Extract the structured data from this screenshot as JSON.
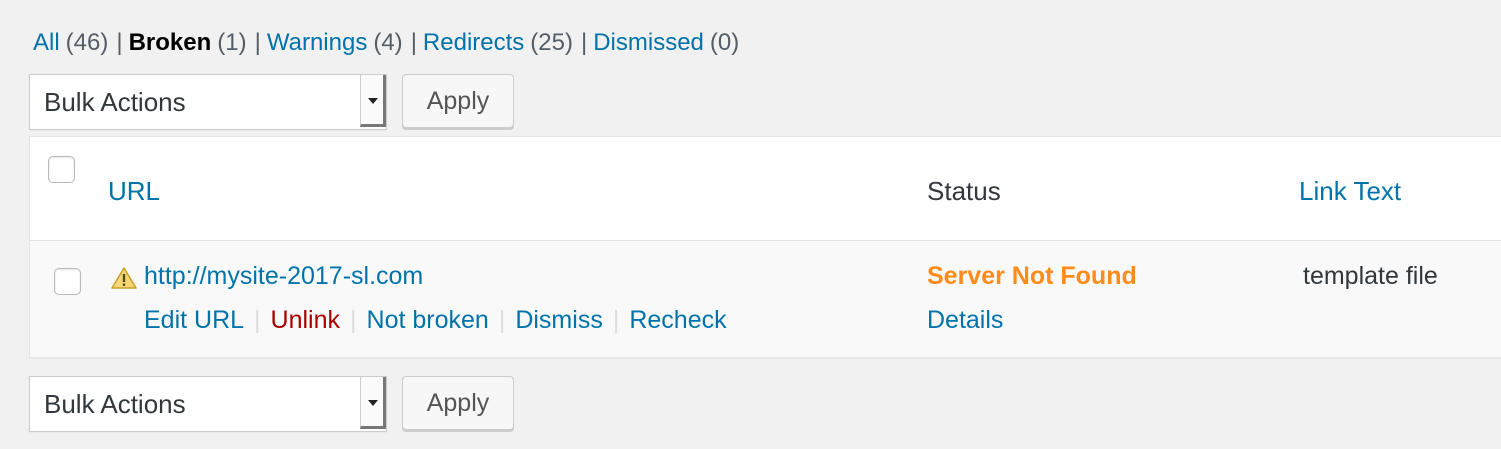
{
  "filters": [
    {
      "label": "All",
      "count": "(46)"
    },
    {
      "label": "Broken",
      "count": "(1)"
    },
    {
      "label": "Warnings",
      "count": "(4)"
    },
    {
      "label": "Redirects",
      "count": "(25)"
    },
    {
      "label": "Dismissed",
      "count": "(0)"
    }
  ],
  "filter_separator": "|",
  "bulk_actions": {
    "top": {
      "select_label": "Bulk Actions",
      "apply_label": "Apply"
    },
    "bottom": {
      "select_label": "Bulk Actions",
      "apply_label": "Apply"
    }
  },
  "table": {
    "columns": {
      "url": "URL",
      "status": "Status",
      "link_text": "Link Text"
    },
    "rows": [
      {
        "url": "http://mysite-2017-sl.com",
        "actions": [
          "Edit URL",
          "Unlink",
          "Not broken",
          "Dismiss",
          "Recheck"
        ],
        "action_separator": "|",
        "status": "Server Not Found",
        "status_link": "Details",
        "link_text": "template file"
      }
    ]
  },
  "colors": {
    "link": "#0073aa",
    "danger": "#a00000",
    "status_warning": "#ff8c1a",
    "warning_icon": "#f0c33c"
  },
  "icons": {
    "row_status": "warning-triangle-icon",
    "select": "dropdown-arrow-icon"
  }
}
